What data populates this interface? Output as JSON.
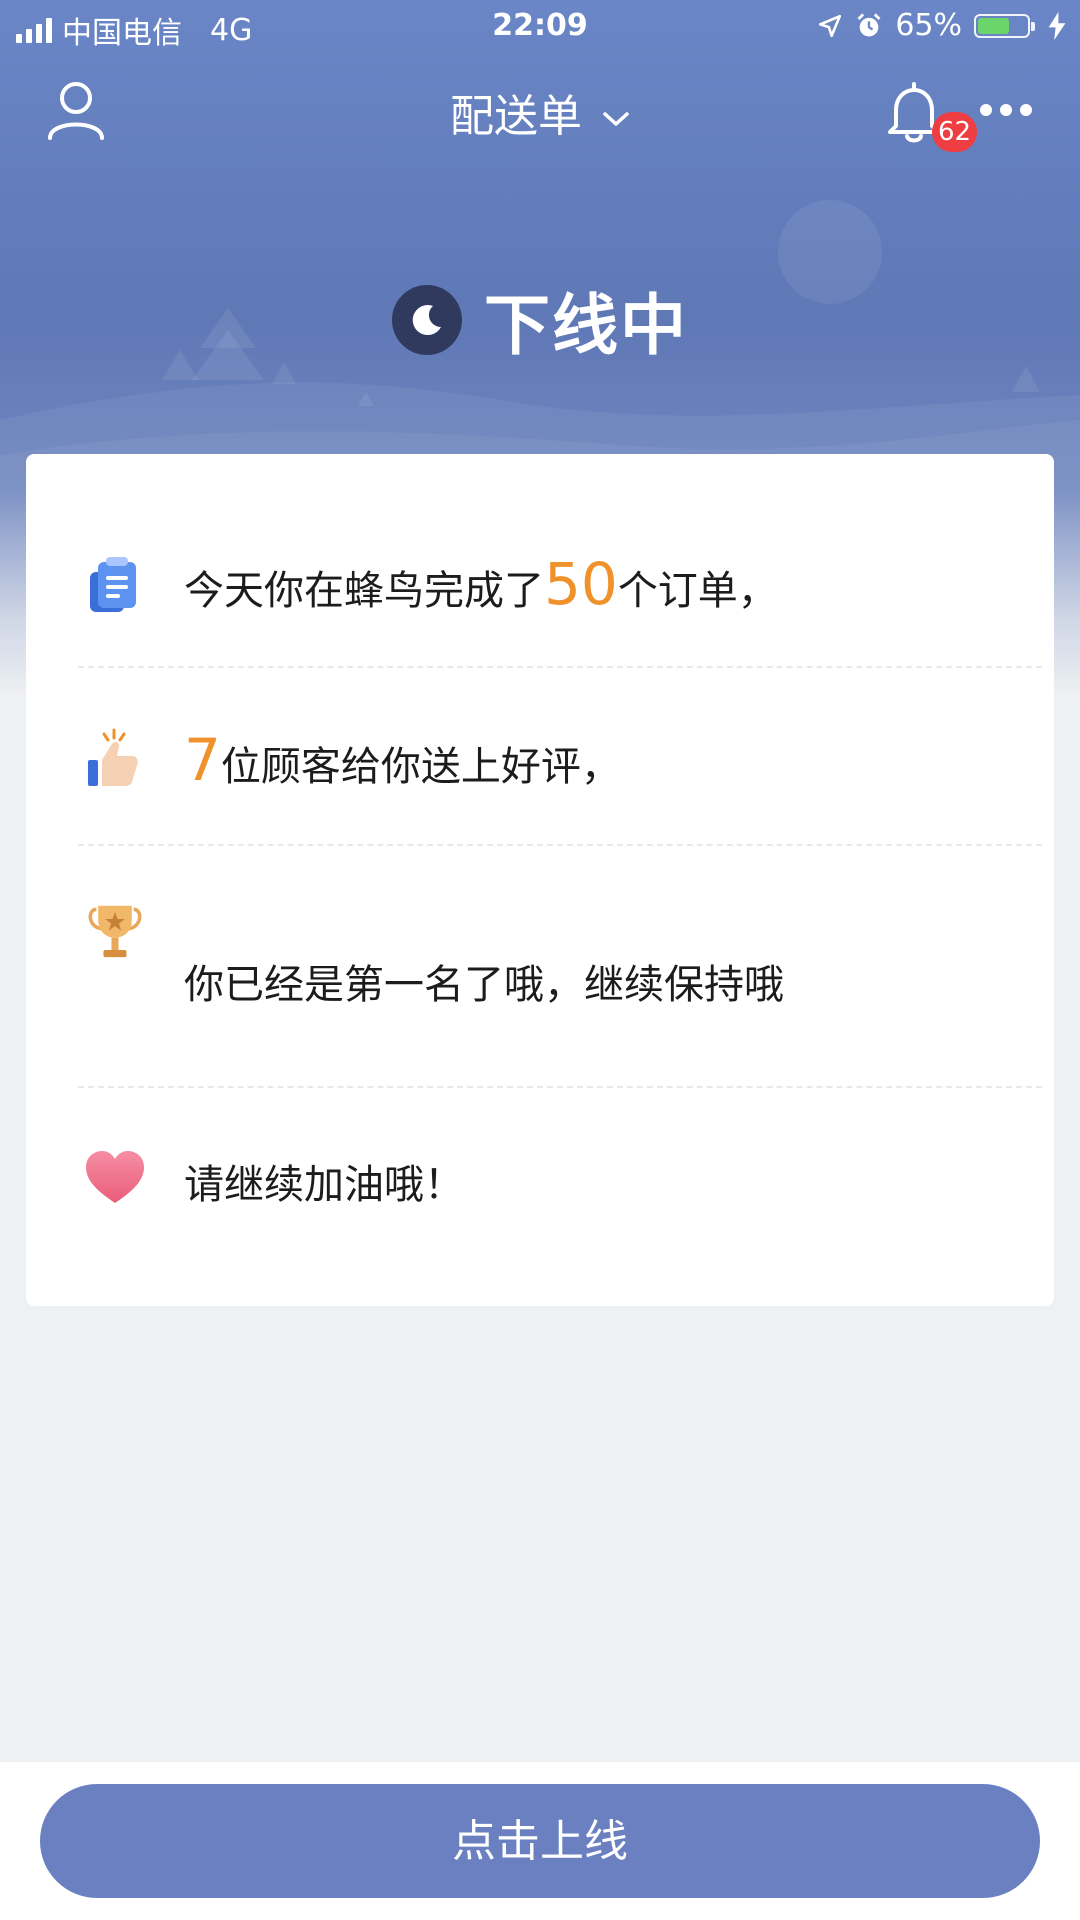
{
  "status_bar": {
    "carrier": "中国电信",
    "network": "4G",
    "time": "22:09",
    "battery_percent": "65%",
    "battery_level": 0.65,
    "battery_color": "#6bd46a"
  },
  "nav": {
    "title": "配送单",
    "notification_count": "62",
    "icons": [
      "user-icon",
      "chevron-down-icon",
      "bell-icon",
      "more-icon"
    ]
  },
  "state": {
    "label": "下线中",
    "icon": "moon-icon"
  },
  "summary": {
    "row1": {
      "icon": "clipboard-icon",
      "prefix": "今天你在蜂鸟完成了",
      "number": "50",
      "suffix": "个订单，"
    },
    "row2": {
      "icon": "thumbs-up-icon",
      "number": "7",
      "suffix": "位顾客给你送上好评，"
    },
    "row3": {
      "icon": "trophy-icon",
      "text": "你已经是第一名了哦，继续保持哦"
    },
    "row4": {
      "icon": "heart-icon",
      "text": "请继续加油哦！"
    }
  },
  "action": {
    "button_label": "点击上线"
  },
  "colors": {
    "accent": "#6a80c0",
    "number": "#f0922b",
    "badge": "#ef3e41"
  }
}
